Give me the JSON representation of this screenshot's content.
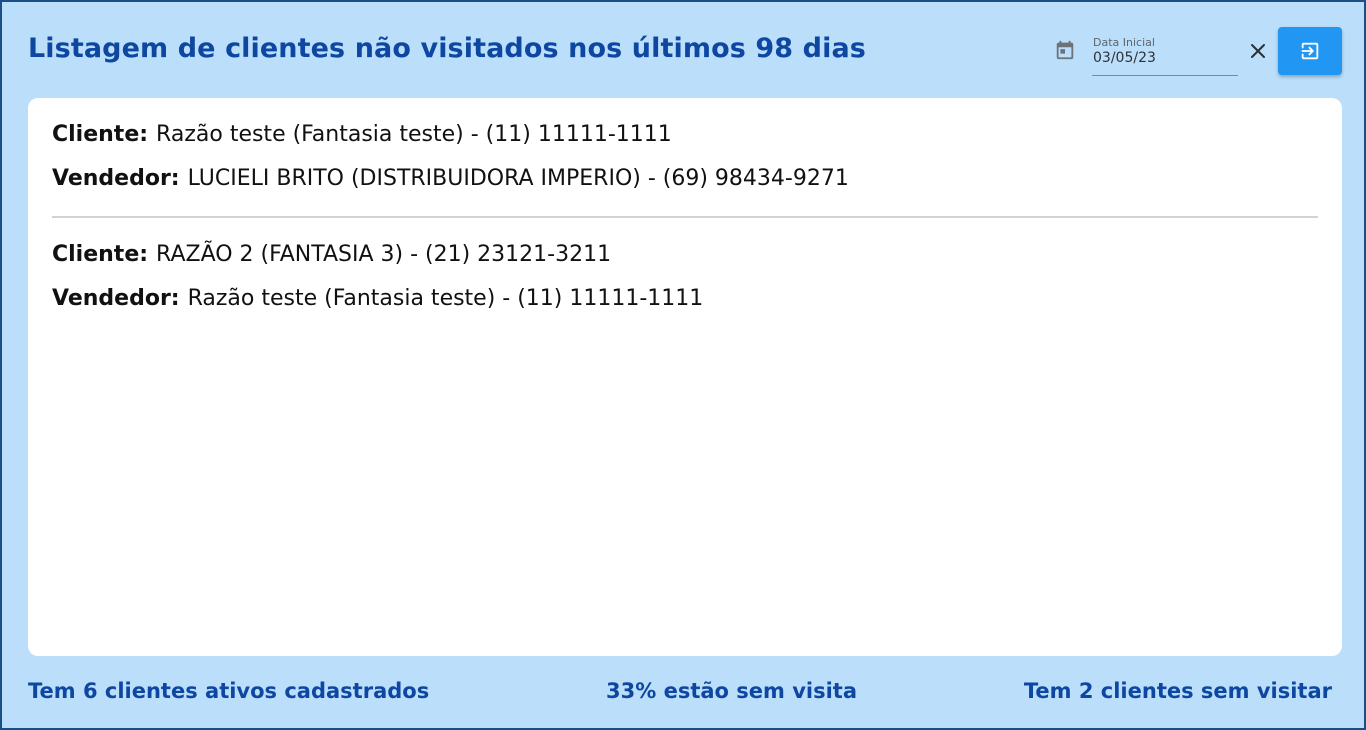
{
  "header": {
    "title": "Listagem de clientes não visitados nos últimos 98 dias",
    "date_field": {
      "label": "Data Inicial",
      "value": "03/05/23"
    },
    "icons": {
      "calendar": "calendar-icon",
      "clear": "close-icon",
      "exit": "exit-icon"
    }
  },
  "entries": [
    {
      "cliente_label": "Cliente:",
      "cliente_value": "Razão teste (Fantasia teste) - (11) 11111-1111",
      "vendedor_label": "Vendedor:",
      "vendedor_value": "LUCIELI BRITO (DISTRIBUIDORA IMPERIO) - (69) 98434-9271"
    },
    {
      "cliente_label": "Cliente:",
      "cliente_value": "RAZÃO 2 (FANTASIA 3) - (21) 23121-3211",
      "vendedor_label": "Vendedor:",
      "vendedor_value": "Razão teste (Fantasia teste) - (11) 11111-1111"
    }
  ],
  "footer": {
    "active_clients": "Tem 6 clientes ativos cadastrados",
    "percent_unvisited": "33% estão sem visita",
    "unvisited_count": "Tem 2 clientes sem visitar"
  },
  "colors": {
    "background": "#bbdefa",
    "title": "#0d47a1",
    "accent_button": "#2196f3",
    "card": "#ffffff"
  }
}
